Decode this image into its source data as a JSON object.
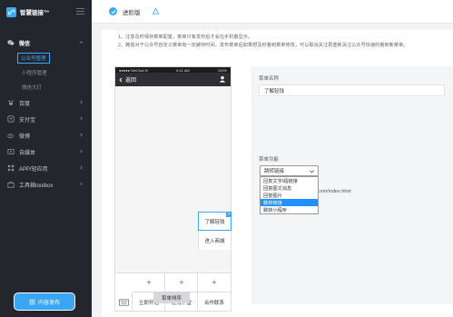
{
  "brand": {
    "name": "智慧链接™"
  },
  "topbar": {
    "title": "进阶版"
  },
  "sidebar": {
    "group": "微信",
    "submenu": [
      "公众号管理",
      "小程序管理",
      "微信大打"
    ],
    "items": [
      "百度",
      "支付宝",
      "微博",
      "自媒体",
      "APP/轻应用",
      "工具箱toolbox"
    ],
    "publish": "内容发布"
  },
  "notes": [
    "1、注意及时保存菜单配置，菜单只有发布后才会在手机看显示。",
    "2、微信对于公众号自定义菜单有一定缓存时间，发布菜单后如果想及时看到菜单修改，可以取消关注再重新关注公众号快速的看到新菜单。"
  ],
  "phone": {
    "status_left": "●●●●● WeChat ≋",
    "status_center": "9:41 AM",
    "status_right": "100%",
    "back": "返回",
    "menu": [
      "立即开始",
      "轻钱学堂",
      "合作联系"
    ],
    "popup": [
      "了解轻钱",
      "进入商城"
    ],
    "sort_button": "菜单排序"
  },
  "form": {
    "name_label": "菜单名称",
    "name_value": "了解轻钱",
    "func_label": "菜单功能",
    "select_value": "跳转链接",
    "options": [
      "回复文字/超链接",
      "回复图文消息",
      "回复图片",
      "跳转链接",
      "跳转小程序"
    ],
    "selected_index": 3,
    "url_partial": "na.com/index.html"
  }
}
